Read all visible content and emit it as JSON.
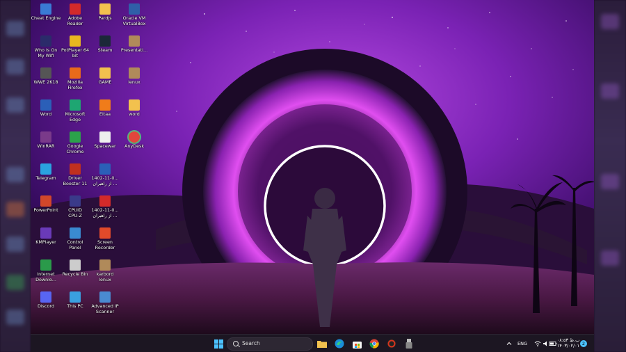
{
  "desktop": {
    "icons": [
      {
        "label": "Cheat Engine",
        "icon": "cheat-engine-icon",
        "color": "#3a7bd5"
      },
      {
        "label": "Adobe\nReader",
        "icon": "adobe-reader-icon",
        "color": "#d42a2a"
      },
      {
        "label": "Pardjs",
        "icon": "folder-icon",
        "color": "#f2c14e"
      },
      {
        "label": "Oracle VM\nVirtualBox",
        "icon": "virtualbox-icon",
        "color": "#2f5fa8"
      },
      {
        "label": "Who Is On\nMy Wifi",
        "icon": "wifi-network-icon",
        "color": "#2b2b6a"
      },
      {
        "label": "PotPlayer 64\nbit",
        "icon": "potplayer-icon",
        "color": "#e8b820"
      },
      {
        "label": "Steam",
        "icon": "steam-icon",
        "color": "#1b2838"
      },
      {
        "label": "Presentati...",
        "icon": "presentation-file-icon",
        "color": "#b08a5a"
      },
      {
        "label": "WWE 2K18",
        "icon": "wwe-game-icon",
        "color": "#555555"
      },
      {
        "label": "Mozilla\nFirefox",
        "icon": "firefox-icon",
        "color": "#e86a1a"
      },
      {
        "label": "GAME",
        "icon": "folder-icon",
        "color": "#f2c14e"
      },
      {
        "label": "lenux",
        "icon": "archive-file-icon",
        "color": "#b08a5a"
      },
      {
        "label": "Word",
        "icon": "word-icon",
        "color": "#2b5fb8"
      },
      {
        "label": "Microsoft\nEdge",
        "icon": "edge-icon",
        "color": "#1ea672"
      },
      {
        "label": "Eitaa",
        "icon": "eitaa-icon",
        "color": "#f07c1a"
      },
      {
        "label": "word",
        "icon": "folder-icon",
        "color": "#f2c14e"
      },
      {
        "label": "WinRAR",
        "icon": "winrar-icon",
        "color": "#7a3a8a"
      },
      {
        "label": "Google\nChrome",
        "icon": "chrome-icon",
        "color": "#2ca24b"
      },
      {
        "label": "Spacewar",
        "icon": "document-file-icon",
        "color": "#eeeeee"
      },
      {
        "label": "AnyDesk",
        "icon": "anydesk-icon",
        "color": "#e2453c"
      },
      {
        "label": "Telegram",
        "icon": "telegram-icon",
        "color": "#2aa3e0"
      },
      {
        "label": "Driver\nBooster 11",
        "icon": "driver-booster-icon",
        "color": "#c0301e"
      },
      {
        "label": "1402-11-0...\nاز راهبران ...",
        "icon": "word-document-icon",
        "color": "#2b5fb8"
      },
      {
        "label": "PowerPoint",
        "icon": "powerpoint-icon",
        "color": "#d2472a"
      },
      {
        "label": "CPUID\nCPU-Z",
        "icon": "cpuz-icon",
        "color": "#3a3a8a"
      },
      {
        "label": "1402-11-0...\nاز راهبران ...",
        "icon": "pdf-document-icon",
        "color": "#d42a2a"
      },
      {
        "label": "KMPlayer",
        "icon": "kmplayer-icon",
        "color": "#6a3ab8"
      },
      {
        "label": "Control\nPanel",
        "icon": "control-panel-icon",
        "color": "#3a8ad0"
      },
      {
        "label": "Screen\nRecorder",
        "icon": "screen-recorder-icon",
        "color": "#e24a2a"
      },
      {
        "label": "Internet\nDownlo...",
        "icon": "internet-download-manager-icon",
        "color": "#2a9a4a"
      },
      {
        "label": "Recycle Bin",
        "icon": "recycle-bin-icon",
        "color": "#cccccc"
      },
      {
        "label": "karbord\nlenux",
        "icon": "archive-file-icon",
        "color": "#b08a5a"
      },
      {
        "label": "Discord",
        "icon": "discord-icon",
        "color": "#5865f2"
      },
      {
        "label": "This PC",
        "icon": "computer-icon",
        "color": "#3aa0e0"
      },
      {
        "label": "Advanced IP\nScanner",
        "icon": "ip-scanner-icon",
        "color": "#4a8ad0"
      }
    ]
  },
  "taskbar": {
    "search_placeholder": "Search",
    "apps": [
      {
        "name": "start-button",
        "icon": "windows-logo-icon",
        "color": "#4cc2ff"
      },
      {
        "name": "file-explorer-button",
        "icon": "folder-icon",
        "color": "#f2c14e"
      },
      {
        "name": "edge-taskbar-button",
        "icon": "edge-icon",
        "color": "#1ea672"
      },
      {
        "name": "store-taskbar-button",
        "icon": "store-icon",
        "color": "#ffffff"
      },
      {
        "name": "chrome-taskbar-button",
        "icon": "chrome-icon",
        "color": "#2ca24b"
      },
      {
        "name": "driver-booster-taskbar-button",
        "icon": "driver-booster-icon",
        "color": "#c0301e"
      },
      {
        "name": "usb-tool-taskbar-button",
        "icon": "usb-drive-icon",
        "color": "#bbbbbb"
      }
    ],
    "tray": {
      "language": "ENG",
      "time": "۰۸:۵۳ ب.ظ",
      "date": "۱۴۰۳/۰۲/۰۱",
      "notification_count": "2"
    }
  }
}
